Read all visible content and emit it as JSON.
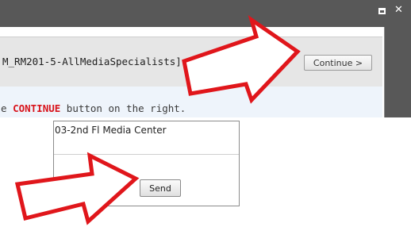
{
  "window": {
    "maximize_icon": "maximize-icon",
    "close_icon": "close-icon",
    "close_glyph": "✕"
  },
  "dialog": {
    "group_name": "M_RM201-5-AllMediaSpecialists]",
    "continue_label": "Continue >",
    "instruction": {
      "before": "e ",
      "keyword": "CONTINUE",
      "after": " button on the right."
    }
  },
  "send_panel": {
    "location": "03-2nd Fl Media Center",
    "send_label": "Send"
  },
  "annotations": {
    "arrow_color": "#e0161b",
    "arrow_icons": [
      "arrow-to-continue-icon",
      "arrow-to-send-icon"
    ]
  }
}
